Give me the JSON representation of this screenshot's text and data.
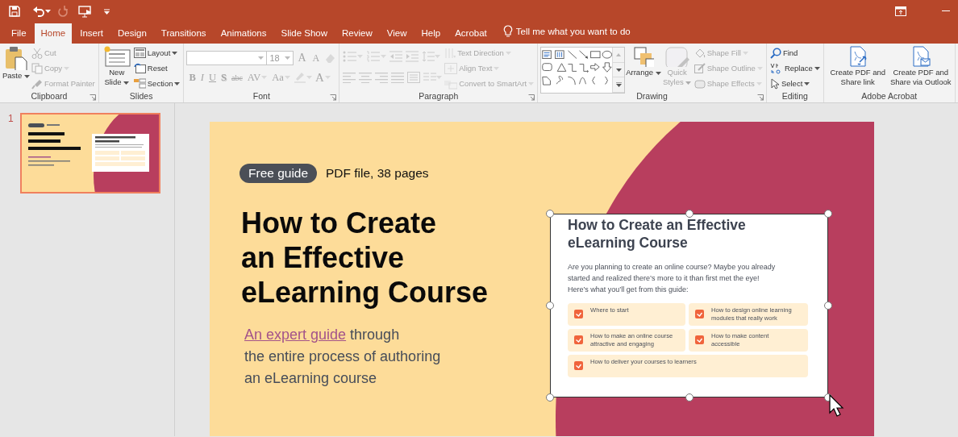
{
  "tabs": [
    {
      "label": "File",
      "selected": false
    },
    {
      "label": "Home",
      "selected": true
    },
    {
      "label": "Insert",
      "selected": false
    },
    {
      "label": "Design",
      "selected": false
    },
    {
      "label": "Transitions",
      "selected": false
    },
    {
      "label": "Animations",
      "selected": false
    },
    {
      "label": "Slide Show",
      "selected": false
    },
    {
      "label": "Review",
      "selected": false
    },
    {
      "label": "View",
      "selected": false
    },
    {
      "label": "Help",
      "selected": false
    },
    {
      "label": "Acrobat",
      "selected": false
    }
  ],
  "tell_me": "Tell me what you want to do",
  "ribbon": {
    "clipboard": {
      "label": "Clipboard",
      "paste": {
        "label": "Paste"
      },
      "cut": {
        "label": "Cut",
        "disabled": true
      },
      "copy": {
        "label": "Copy",
        "disabled": true
      },
      "format_painter": {
        "label": "Format Painter",
        "disabled": true
      }
    },
    "slides": {
      "label": "Slides",
      "new_slide": {
        "label": "New Slide"
      },
      "layout": {
        "label": "Layout"
      },
      "reset": {
        "label": "Reset"
      },
      "section": {
        "label": "Section"
      }
    },
    "font": {
      "label": "Font",
      "disabled": true,
      "font_size": "18",
      "row1": [
        {
          "kind": "grow",
          "text": "A"
        },
        {
          "kind": "shrink",
          "text": "A"
        }
      ],
      "row2": [
        {
          "kind": "bold",
          "text": "B"
        },
        {
          "kind": "italic",
          "text": "I"
        },
        {
          "kind": "underline",
          "text": "U"
        },
        {
          "kind": "shadow",
          "text": "S"
        },
        {
          "kind": "strike",
          "text": "abc"
        },
        {
          "kind": "spacing",
          "text": "AV"
        },
        {
          "kind": "case",
          "text": "Aa"
        }
      ],
      "font_color": "A"
    },
    "paragraph": {
      "label": "Paragraph",
      "disabled": true,
      "text_direction": "Text Direction",
      "align_text": "Align Text",
      "convert": "Convert to SmartArt"
    },
    "drawing": {
      "label": "Drawing",
      "arrange": {
        "label": "Arrange"
      },
      "quick_styles": {
        "label": "Quick Styles",
        "disabled": true
      },
      "shape_fill": {
        "label": "Shape Fill",
        "disabled": true
      },
      "shape_outline": {
        "label": "Shape Outline",
        "disabled": true
      },
      "shape_effects": {
        "label": "Shape Effects",
        "disabled": true
      }
    },
    "editing": {
      "label": "Editing",
      "find": {
        "label": "Find"
      },
      "replace": {
        "label": "Replace"
      },
      "select": {
        "label": "Select"
      }
    },
    "acrobat": {
      "label": "Adobe Acrobat",
      "share_link": {
        "label": "Create PDF and Share link"
      },
      "share_outlook": {
        "label": "Create PDF and Share via Outlook"
      }
    }
  },
  "slides_pane": {
    "number": "1",
    "selected": true
  },
  "slide": {
    "badge": "Free guide",
    "meta": "PDF file, 38 pages",
    "title": "How to Create\nan Effective\neLearning Course",
    "subtitle_link": "An expert guide",
    "subtitle": "through\nthe entire process of authoring\nan eLearning course",
    "card": {
      "selected": true,
      "title": "How to Create an Effective\neLearning Course",
      "intro": "Are you planning to create an online course? Maybe you already\nstarted and realized there’s more to it than first met the eye!\nHere’s what you’ll get from this guide:",
      "items": [
        {
          "text": "Where to start",
          "checked": true
        },
        {
          "text": "How to design online learning\nmodules that really work",
          "checked": true
        },
        {
          "text": "How to make an online course\nattractive and engaging",
          "checked": true
        },
        {
          "text": "How to make content\naccessible",
          "checked": true
        },
        {
          "text": "How to deliver your courses to learners",
          "checked": true
        }
      ]
    }
  }
}
